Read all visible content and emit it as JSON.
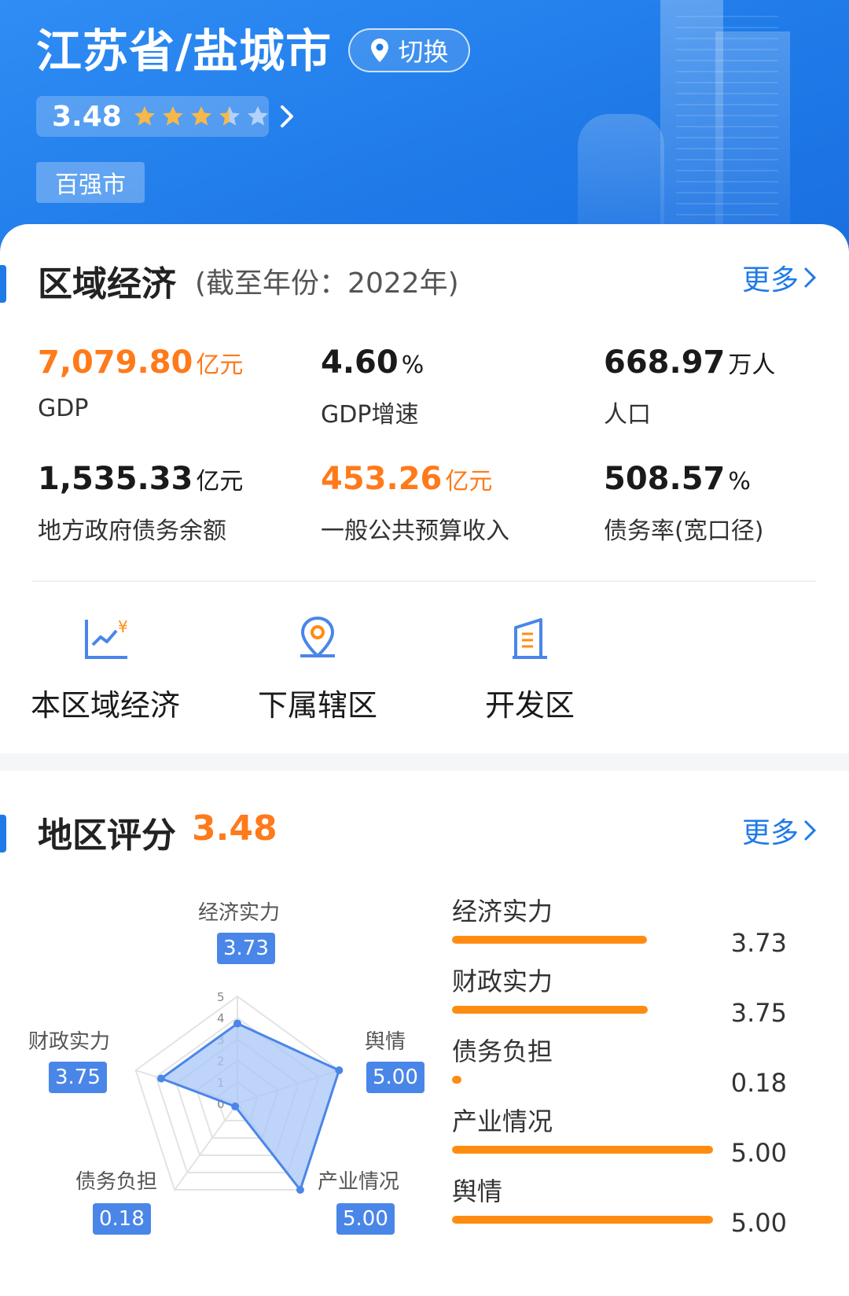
{
  "header": {
    "location": "江苏省/盐城市",
    "switch_label": "切换",
    "rating": "3.48",
    "rating_value": 3.48,
    "tag": "百强市",
    "star_color": "#f7b84a",
    "bg_color": "#1f7ae8"
  },
  "economy": {
    "title": "区域经济",
    "subtitle": "(截至年份：2022年)",
    "more": "更多",
    "metrics": [
      {
        "value": "7,079.80",
        "unit": "亿元",
        "label": "GDP",
        "color": "orange"
      },
      {
        "value": "4.60",
        "unit": "%",
        "label": "GDP增速",
        "color": "dark"
      },
      {
        "value": "668.97",
        "unit": "万人",
        "label": "人口",
        "color": "dark"
      },
      {
        "value": "1,535.33",
        "unit": "亿元",
        "label": "地方政府债务余额",
        "color": "dark"
      },
      {
        "value": "453.26",
        "unit": "亿元",
        "label": "一般公共预算收入",
        "color": "orange"
      },
      {
        "value": "508.57",
        "unit": "%",
        "label": "债务率(宽口径)",
        "color": "dark"
      }
    ],
    "nav": [
      {
        "label": "本区域经济",
        "icon": "chart-yuan-icon"
      },
      {
        "label": "下属辖区",
        "icon": "map-pin-icon"
      },
      {
        "label": "开发区",
        "icon": "building-icon"
      }
    ]
  },
  "score": {
    "title": "地区评分",
    "value": "3.48",
    "more": "更多",
    "ticks": [
      "0",
      "1",
      "2",
      "3",
      "4",
      "5"
    ],
    "items": [
      {
        "name": "经济实力",
        "value": "3.73",
        "num": 3.73
      },
      {
        "name": "财政实力",
        "value": "3.75",
        "num": 3.75
      },
      {
        "name": "债务负担",
        "value": "0.18",
        "num": 0.18
      },
      {
        "name": "产业情况",
        "value": "5.00",
        "num": 5.0
      },
      {
        "name": "舆情",
        "value": "5.00",
        "num": 5.0
      }
    ],
    "bar_color": "#ff8c12",
    "radar_fill": "#a9c6f7",
    "radar_stroke": "#4a86e8"
  }
}
